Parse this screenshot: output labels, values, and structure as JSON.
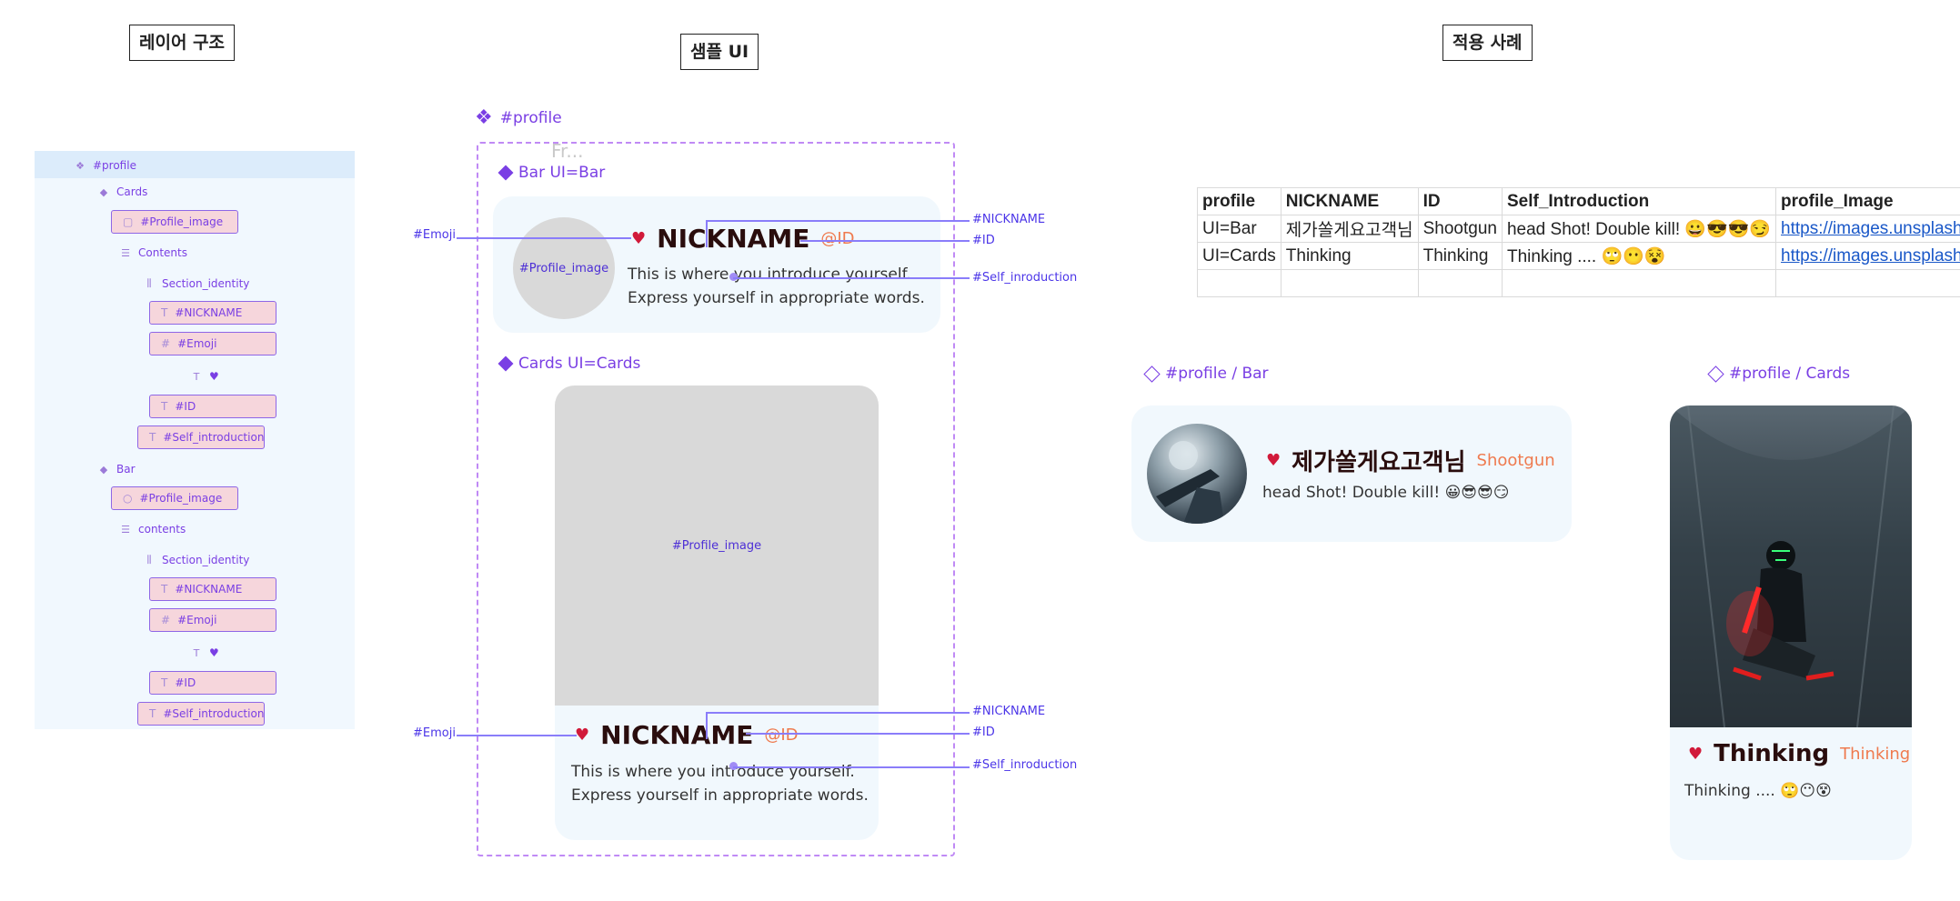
{
  "sections": {
    "layer_title": "레이어 구조",
    "sample_title": "샘플 UI",
    "applied_title": "적용 사례"
  },
  "layers": {
    "root": "#profile",
    "cards": "Cards",
    "cards_profile_image": "#Profile_image",
    "cards_contents": "Contents",
    "cards_section_identity": "Section_identity",
    "cards_nickname": "#NICKNAME",
    "cards_emoji": "#Emoji",
    "cards_heart": "♥",
    "cards_id": "#ID",
    "cards_self_intro": "#Self_introduction",
    "bar": "Bar",
    "bar_profile_image": "#Profile_image",
    "bar_contents": "contents",
    "bar_section_identity": "Section_identity",
    "bar_nickname": "#NICKNAME",
    "bar_emoji": "#Emoji",
    "bar_heart": "♥",
    "bar_id": "#ID",
    "bar_self_intro": "#Self_introduction"
  },
  "sample": {
    "component_label": "#profile",
    "frame_label": "Fr...",
    "bar_variant_label": "Bar UI=Bar",
    "cards_variant_label": "Cards  UI=Cards",
    "profile_image_placeholder": "#Profile_image",
    "heart": "♥",
    "nickname": "NICKNAME",
    "id": "@ID",
    "intro_line1": "This is where you introduce yourself.",
    "intro_line2": "Express yourself in appropriate words.",
    "annotations": {
      "emoji": "#Emoji",
      "nickname": "#NICKNAME",
      "id": "#ID",
      "self_intro": "#Self_inroduction"
    }
  },
  "sheet": {
    "headers": [
      "profile",
      "NICKNAME",
      "ID",
      "Self_Introduction",
      "profile_Image"
    ],
    "rows": [
      [
        "UI=Bar",
        "제가쏠게요고객님",
        "Shootgun",
        "head Shot! Double kill! 😀😎😎😏",
        "https://images.unsplash.com"
      ],
      [
        "UI=Cards",
        "Thinking",
        "Thinking",
        "Thinking .... 🙄😶😵",
        "https://images.unsplash.com"
      ]
    ]
  },
  "applied": {
    "bar_label": "#profile / Bar",
    "cards_label": "#profile / Cards",
    "bar_nickname": "제가쏠게요고객님",
    "bar_id": "Shootgun",
    "bar_intro": "head Shot! Double kill! 😀😎😎😏",
    "cards_nickname": "Thinking",
    "cards_id": "Thinking",
    "cards_intro": "Thinking .... 🙄😶😵",
    "heart": "♥"
  },
  "colors": {
    "accent": "#7a3fe4",
    "annotation": "#4b35e8",
    "id_orange": "#ef7a4e",
    "heart_red": "#d11a3a",
    "card_bg": "#f1f8fd"
  }
}
